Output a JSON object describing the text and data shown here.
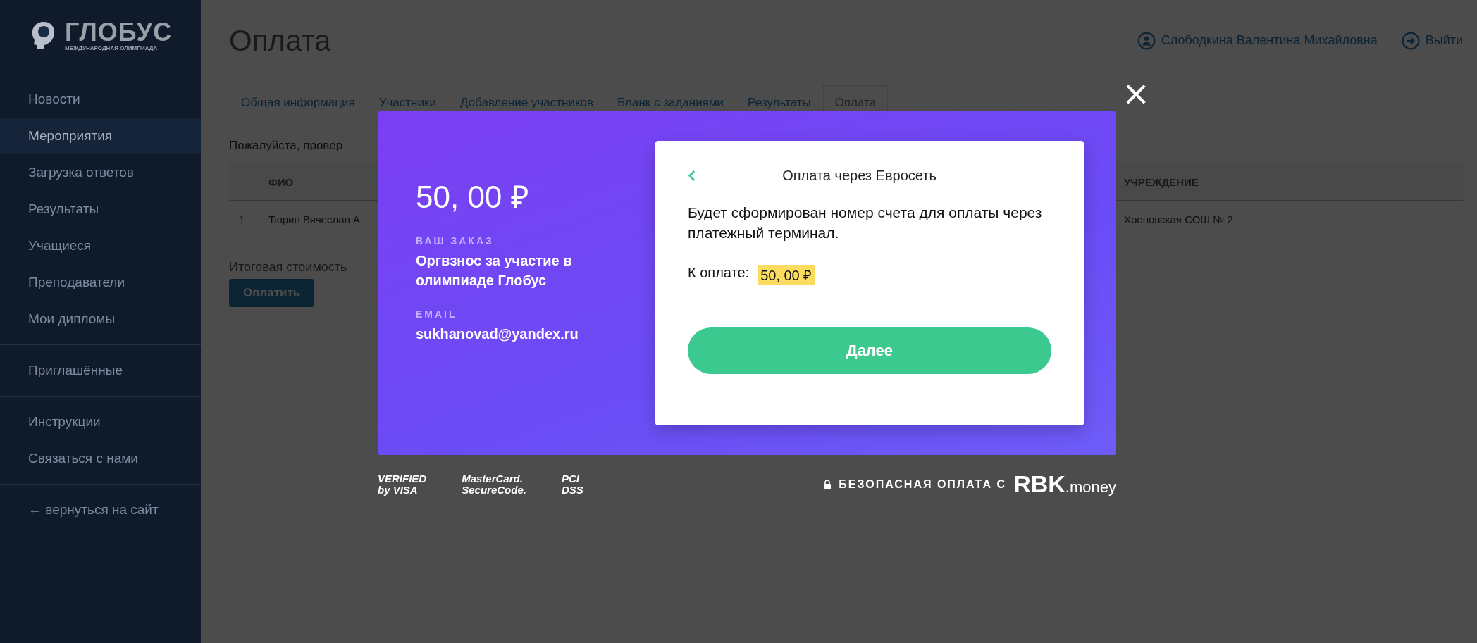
{
  "sidebar": {
    "logo": {
      "name": "ГЛОБУС",
      "tagline": "МЕЖДУНАРОДНАЯ ОЛИМПИАДА"
    },
    "sections": [
      {
        "items": [
          {
            "label": "Новости",
            "selected": false
          },
          {
            "label": "Мероприятия",
            "selected": true
          },
          {
            "label": "Загрузка ответов",
            "selected": false
          },
          {
            "label": "Результаты",
            "selected": false
          },
          {
            "label": "Учащиеся",
            "selected": false
          },
          {
            "label": "Преподаватели",
            "selected": false
          },
          {
            "label": "Мои дипломы",
            "selected": false
          }
        ]
      },
      {
        "items": [
          {
            "label": "Приглашённые",
            "selected": false
          }
        ]
      },
      {
        "items": [
          {
            "label": "Инструкции",
            "selected": false
          },
          {
            "label": "Связаться с нами",
            "selected": false
          }
        ]
      },
      {
        "items": [
          {
            "label": "← вернуться на сайт",
            "selected": false
          }
        ]
      }
    ]
  },
  "header": {
    "title": "Оплата",
    "user": "Слободкина Валентина Михайловна",
    "logout": "Выйти"
  },
  "tabs": [
    {
      "label": "Общая информация",
      "selected": false
    },
    {
      "label": "Участники",
      "selected": false
    },
    {
      "label": "Добавление участников",
      "selected": false
    },
    {
      "label": "Бланк с заданиями",
      "selected": false
    },
    {
      "label": "Результаты",
      "selected": false
    },
    {
      "label": "Оплата",
      "selected": true
    }
  ],
  "notice": "Пожалуйста, провер",
  "table": {
    "columns": [
      "",
      "ФИО",
      "УЧРЕЖДЕНИЕ"
    ],
    "rows": [
      [
        "1",
        "Тюрин Вячеслав А",
        "Хреновская СОШ № 2"
      ]
    ]
  },
  "total_label": "Итоговая стоимость",
  "pay_button": "Оплатить",
  "modal": {
    "amount": "50, 00 ₽",
    "order_label": "ВАШ ЗАКАЗ",
    "order": "Оргвзнос за участие в олимпиаде Глобус",
    "email_label": "EMAIL",
    "email": "sukhanovad@yandex.ru",
    "card": {
      "title": "Оплата через Евросеть",
      "text": "Будет сформирован номер счета для оплаты через платежный терминал.",
      "due_label": "К оплате:",
      "due_amount": "50, 00 ₽",
      "button": "Далее"
    },
    "close": "×"
  },
  "footer": {
    "badges": [
      {
        "top": "VERIFIED",
        "bottom": "by VISA"
      },
      {
        "top": "MasterCard.",
        "bottom": "SecureCode."
      },
      {
        "top": "PCI",
        "bottom": "DSS"
      }
    ],
    "secure_text": "БЕЗОПАСНАЯ ОПЛАТА С",
    "brand": "RBK",
    "brand_suffix": ".money"
  }
}
